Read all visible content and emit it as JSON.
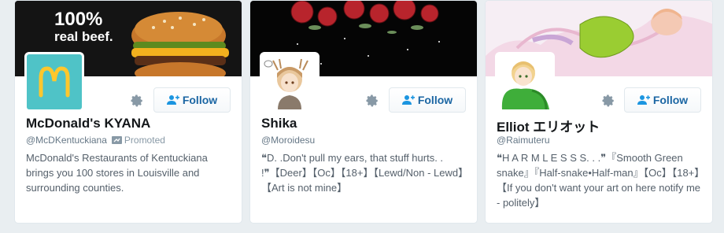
{
  "cards": [
    {
      "banner_text_line1": "100%",
      "banner_text_line2": "real beef.",
      "name": "McDonald's KYANA",
      "handle": "@McDKentuckiana",
      "promoted_label": "Promoted",
      "follow_label": "Follow",
      "bio": "McDonald's Restaurants of Kentuckiana brings you 100 stores in Louisville and surrounding counties.",
      "avatar_icon": "golden-arches-logo",
      "colors": {
        "avatar_bg": "#4fc3c7",
        "arches": "#ffc72c",
        "banner_bg": "#111111"
      }
    },
    {
      "name": "Shika",
      "handle": "@Moroidesu",
      "follow_label": "Follow",
      "bio": "❝D. .Don't pull my ears, that stuff hurts. . !❞【Deer】【Oc】【18+】【Lewd/Non - Lewd】【Art is not mine】",
      "avatar_icon": "anime-deer-character-avatar",
      "colors": {
        "banner_bg": "#050505",
        "roses": "#b8242c"
      }
    },
    {
      "name": "Elliot エリオット",
      "handle": "@Raimuteru",
      "follow_label": "Follow",
      "bio": "❝H A R M L E S S S. . .❞『Smooth Green snake』『Half-snake•Half-man』【Oc】【18+】【If you don't want your art on here notify me - politely】",
      "avatar_icon": "anime-character-green-snake-avatar",
      "colors": {
        "banner_bg": "#f6eef4",
        "snake": "#9acd32"
      }
    }
  ],
  "icons": {
    "gear": "gear-icon",
    "follow": "add-user-icon",
    "promoted": "promoted-icon"
  }
}
